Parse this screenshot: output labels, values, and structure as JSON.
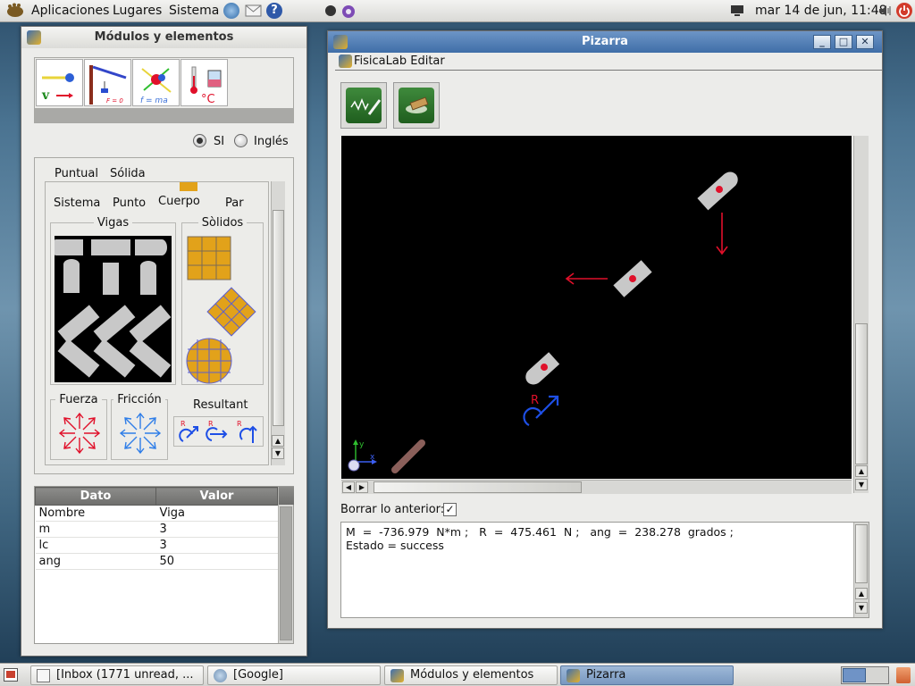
{
  "top_panel": {
    "menus": [
      "Aplicaciones",
      "Lugares",
      "Sistema"
    ],
    "clock": "mar 14 de jun, 11:48"
  },
  "modules_window": {
    "title": "Módulos y elementos",
    "unit_options": [
      "SI",
      "Inglés"
    ],
    "tabs": [
      "Puntual",
      "Sólida"
    ],
    "element_labels": [
      "Sistema",
      "Punto",
      "Cuerpo",
      "Par"
    ],
    "groups": {
      "vigas": "Vigas",
      "solidos": "Sòlidos",
      "fuerza": "Fuerza",
      "friccion": "Fricción",
      "resultant": "Resultant"
    },
    "tool_labels": {
      "static": "F = 0",
      "dynamic": "f = ma",
      "temp": "°C"
    },
    "properties": {
      "headers": [
        "Dato",
        "Valor"
      ],
      "rows": [
        [
          "Nombre",
          "Viga"
        ],
        [
          "m",
          "3"
        ],
        [
          "lc",
          "3"
        ],
        [
          "ang",
          "50"
        ]
      ]
    }
  },
  "pizarra_window": {
    "title": "Pizarra",
    "menu": "FisicaLab Editar",
    "borrar_label": "Borrar lo anterior:",
    "borrar_checked": "✓",
    "output_lines": [
      "M  =  -736.979  N*m ;   R  =  475.461  N ;   ang  =  238.278  grados ;",
      "Estado = success"
    ],
    "resultant_label": "R",
    "axis_x": "x",
    "axis_y": "y"
  },
  "taskbar": {
    "tasks": [
      "[Inbox (1771 unread, ...",
      "[Google]",
      "Módulos y elementos",
      "Pizarra"
    ]
  },
  "colors": {
    "force_red": "#e0102a",
    "result_blue": "#1e4fe6",
    "solid_gold": "#e2a21a",
    "title_blue": "#4f7db5"
  }
}
